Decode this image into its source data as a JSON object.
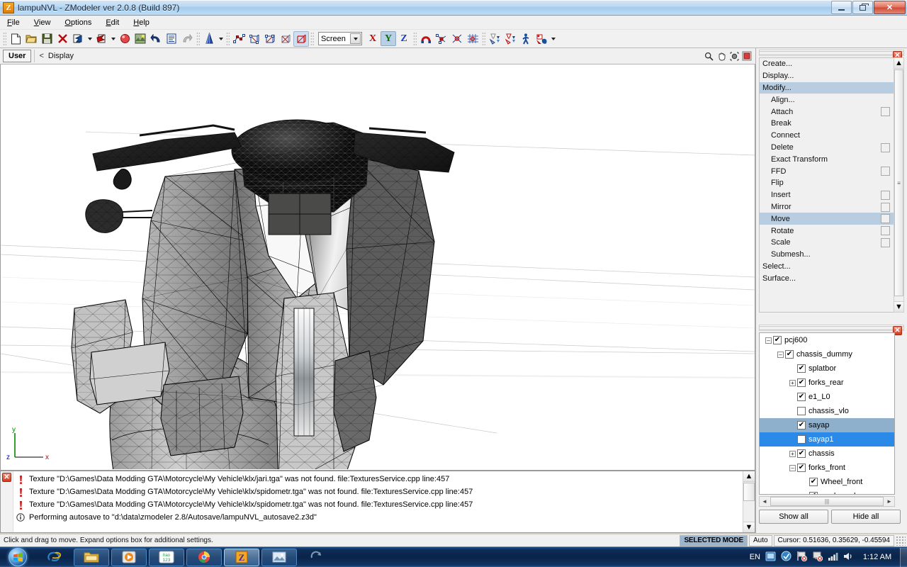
{
  "window": {
    "title": "lampuNVL - ZModeler ver 2.0.8 (Build 897)",
    "app_icon": "zmodeler-z-icon",
    "minimize_label": "",
    "restore_label": "",
    "close_label": "✕"
  },
  "menubar": {
    "items": [
      {
        "label": "File",
        "accel": "F"
      },
      {
        "label": "View",
        "accel": "V"
      },
      {
        "label": "Options",
        "accel": "O"
      },
      {
        "label": "Edit",
        "accel": "E"
      },
      {
        "label": "Help",
        "accel": "H"
      }
    ]
  },
  "toolbar": {
    "groups": [
      {
        "icons": [
          "new-file-icon",
          "open-folder-icon",
          "save-disk-icon",
          "close-x-icon",
          "import-icon",
          "dropdown-arrow",
          "export-icon",
          "dropdown-arrow",
          "render-sphere-icon",
          "materials-icon",
          "undo-icon",
          "properties-icon",
          "redo-icon"
        ]
      },
      {
        "icons": [
          "cone-primitive-icon",
          "dropdown-arrow"
        ]
      },
      {
        "icons": [
          "select-vertex-icon",
          "select-face-icon",
          "select-poly-icon",
          "select-object-icon",
          "select-active-icon"
        ]
      },
      {
        "icons": [
          "coordinate-space-select"
        ]
      },
      {
        "icons": [
          "axis-x",
          "axis-y",
          "axis-z"
        ]
      },
      {
        "icons": [
          "magnet-snap-icon",
          "snap-vertex-icon",
          "snap-edge-icon",
          "snap-grid-icon"
        ]
      },
      {
        "icons": [
          "filter-1-icon",
          "filter-2-icon",
          "biped-icon",
          "render-settings-icon",
          "dropdown-arrow"
        ]
      }
    ],
    "coordinate_space": "Screen",
    "axis_x": "X",
    "axis_y": "Y",
    "axis_z": "Z",
    "axis_active": "Y",
    "active_select_mode": "select-active-icon"
  },
  "viewport": {
    "view_label": "User",
    "chevron": "<",
    "display_label": "Display",
    "tools": [
      "zoom-magnifier-icon",
      "pan-hand-icon",
      "orbit-icon",
      "maximize-viewport-icon"
    ],
    "axis_gizmo": {
      "x": "x",
      "y": "y",
      "z": "z",
      "x_color": "#cc0000",
      "y_color": "#008800",
      "z_color": "#0000cc"
    },
    "scene_description": "3D wireframe motorcycle model, front view, shaded triangular mesh"
  },
  "command_panel": {
    "close_label": "✕",
    "items": [
      {
        "label": "Create...",
        "indent": false,
        "selected": false,
        "option_box": false
      },
      {
        "label": "Display...",
        "indent": false,
        "selected": false,
        "option_box": false
      },
      {
        "label": "Modify...",
        "indent": false,
        "selected": true,
        "option_box": false
      },
      {
        "label": "Align...",
        "indent": true,
        "selected": false,
        "option_box": false
      },
      {
        "label": "Attach",
        "indent": true,
        "selected": false,
        "option_box": true
      },
      {
        "label": "Break",
        "indent": true,
        "selected": false,
        "option_box": false
      },
      {
        "label": "Connect",
        "indent": true,
        "selected": false,
        "option_box": false
      },
      {
        "label": "Delete",
        "indent": true,
        "selected": false,
        "option_box": true
      },
      {
        "label": "Exact Transform",
        "indent": true,
        "selected": false,
        "option_box": false
      },
      {
        "label": "FFD",
        "indent": true,
        "selected": false,
        "option_box": true
      },
      {
        "label": "Flip",
        "indent": true,
        "selected": false,
        "option_box": false
      },
      {
        "label": "Insert",
        "indent": true,
        "selected": false,
        "option_box": true
      },
      {
        "label": "Mirror",
        "indent": true,
        "selected": false,
        "option_box": true
      },
      {
        "label": "Move",
        "indent": true,
        "selected": true,
        "option_box": true
      },
      {
        "label": "Rotate",
        "indent": true,
        "selected": false,
        "option_box": true
      },
      {
        "label": "Scale",
        "indent": true,
        "selected": false,
        "option_box": true
      },
      {
        "label": "Submesh...",
        "indent": true,
        "selected": false,
        "option_box": false
      },
      {
        "label": "Select...",
        "indent": false,
        "selected": false,
        "option_box": false
      },
      {
        "label": "Surface...",
        "indent": false,
        "selected": false,
        "option_box": false
      }
    ]
  },
  "scene_tree": {
    "close_label": "✕",
    "nodes": [
      {
        "label": "pcj600",
        "depth": 0,
        "expander": "minus",
        "checked": true,
        "selection": "none"
      },
      {
        "label": "chassis_dummy",
        "depth": 1,
        "expander": "minus",
        "checked": true,
        "selection": "none"
      },
      {
        "label": "splatbor",
        "depth": 2,
        "expander": "none",
        "checked": true,
        "selection": "none"
      },
      {
        "label": "forks_rear",
        "depth": 2,
        "expander": "plus",
        "checked": true,
        "selection": "none"
      },
      {
        "label": "e1_L0",
        "depth": 2,
        "expander": "none",
        "checked": true,
        "selection": "none"
      },
      {
        "label": "chassis_vlo",
        "depth": 2,
        "expander": "none",
        "checked": false,
        "selection": "none"
      },
      {
        "label": "sayap",
        "depth": 2,
        "expander": "none",
        "checked": true,
        "selection": "soft"
      },
      {
        "label": "sayap1",
        "depth": 2,
        "expander": "none",
        "checked": false,
        "selection": "hard"
      },
      {
        "label": "chassis",
        "depth": 2,
        "expander": "plus",
        "checked": true,
        "selection": "none"
      },
      {
        "label": "forks_front",
        "depth": 2,
        "expander": "minus",
        "checked": true,
        "selection": "none"
      },
      {
        "label": "Wheel_front",
        "depth": 3,
        "expander": "none",
        "checked": true,
        "selection": "none"
      },
      {
        "label": "mudguard",
        "depth": 3,
        "expander": "none",
        "checked": true,
        "selection": "none"
      }
    ],
    "show_all_label": "Show all",
    "hide_all_label": "Hide all"
  },
  "log": {
    "close_label": "✕",
    "entries": [
      {
        "severity": "error",
        "text": "Texture \"D:\\Games\\Data Modding GTA\\Motorcycle\\My Vehicle\\klx/jari.tga\" was not found. file:TexturesService.cpp line:457"
      },
      {
        "severity": "error",
        "text": "Texture \"D:\\Games\\Data Modding GTA\\Motorcycle\\My Vehicle\\klx/spidometr.tga\" was not found. file:TexturesService.cpp line:457"
      },
      {
        "severity": "error",
        "text": "Texture \"D:\\Games\\Data Modding GTA\\Motorcycle\\My Vehicle\\klx/spidometr.tga\" was not found. file:TexturesService.cpp line:457"
      },
      {
        "severity": "info",
        "text": "Performing autosave to \"d:\\data\\zmodeler 2.8/Autosave/lampuNVL_autosave2.z3d\""
      }
    ]
  },
  "statusbar": {
    "hint": "Click and drag to move. Expand options box for additional settings.",
    "selected_mode": "SELECTED MODE",
    "auto": "Auto",
    "cursor": "Cursor: 0.51636, 0.35629, -0.45594"
  },
  "taskbar": {
    "start_label": "start-orb-icon",
    "buttons": [
      {
        "name": "internet-explorer-icon",
        "state": "pinned",
        "glyph": "e"
      },
      {
        "name": "file-explorer-icon",
        "state": "pinned",
        "glyph": "▤"
      },
      {
        "name": "media-player-icon",
        "state": "pinned",
        "glyph": "▶"
      },
      {
        "name": "hao123-icon",
        "state": "pinned",
        "glyph": "hao"
      },
      {
        "name": "google-chrome-icon",
        "state": "pinned",
        "glyph": "◍"
      },
      {
        "name": "zmodeler-icon",
        "state": "active",
        "glyph": "Z"
      },
      {
        "name": "photo-viewer-icon",
        "state": "pinned",
        "glyph": "▣"
      },
      {
        "name": "sync-icon",
        "state": "pinned",
        "glyph": "↻"
      }
    ],
    "tray": {
      "language": "EN",
      "icons": [
        "tablet-icon",
        "security-icon",
        "flag-alert-icon",
        "network-error-icon",
        "signal-bars-icon",
        "volume-icon"
      ],
      "clock": "1:12 AM"
    }
  }
}
